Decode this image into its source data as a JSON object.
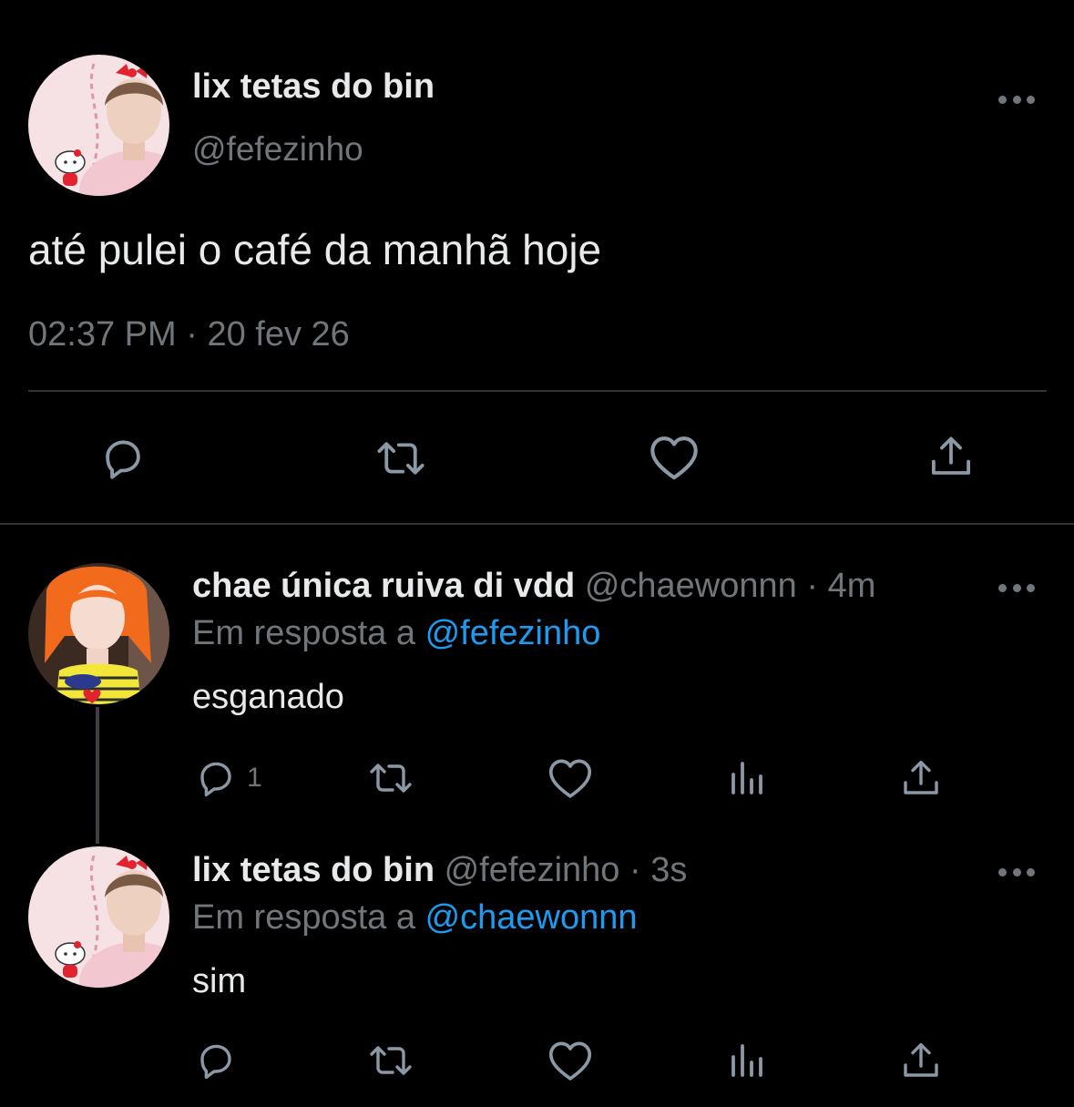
{
  "main_tweet": {
    "display_name": "lix tetas do bin",
    "handle": "@fefezinho",
    "text": "até pulei o café da manhã hoje",
    "time": "02:37 PM",
    "separator": "·",
    "date": "20 fev 26"
  },
  "replies": [
    {
      "display_name": "chae única ruiva di vdd",
      "handle": "@chaewonnn",
      "separator": "·",
      "age": "4m",
      "reply_prefix": "Em resposta a",
      "reply_to": "@fefezinho",
      "text": "esganado",
      "reply_count": "1"
    },
    {
      "display_name": "lix tetas do bin",
      "handle": "@fefezinho",
      "separator": "·",
      "age": "3s",
      "reply_prefix": "Em resposta a",
      "reply_to": "@chaewonnn",
      "text": "sim",
      "reply_count": ""
    }
  ],
  "icons": {
    "reply": "comment-bubble-icon",
    "retweet": "retweet-icon",
    "like": "heart-icon",
    "views": "analytics-bars-icon",
    "share": "share-upload-icon",
    "more": "more-dots-icon"
  },
  "colors": {
    "background": "#000000",
    "text": "#e7e9ea",
    "secondary": "#71767b",
    "mention": "#1d9bf0",
    "divider": "#2f3336"
  }
}
